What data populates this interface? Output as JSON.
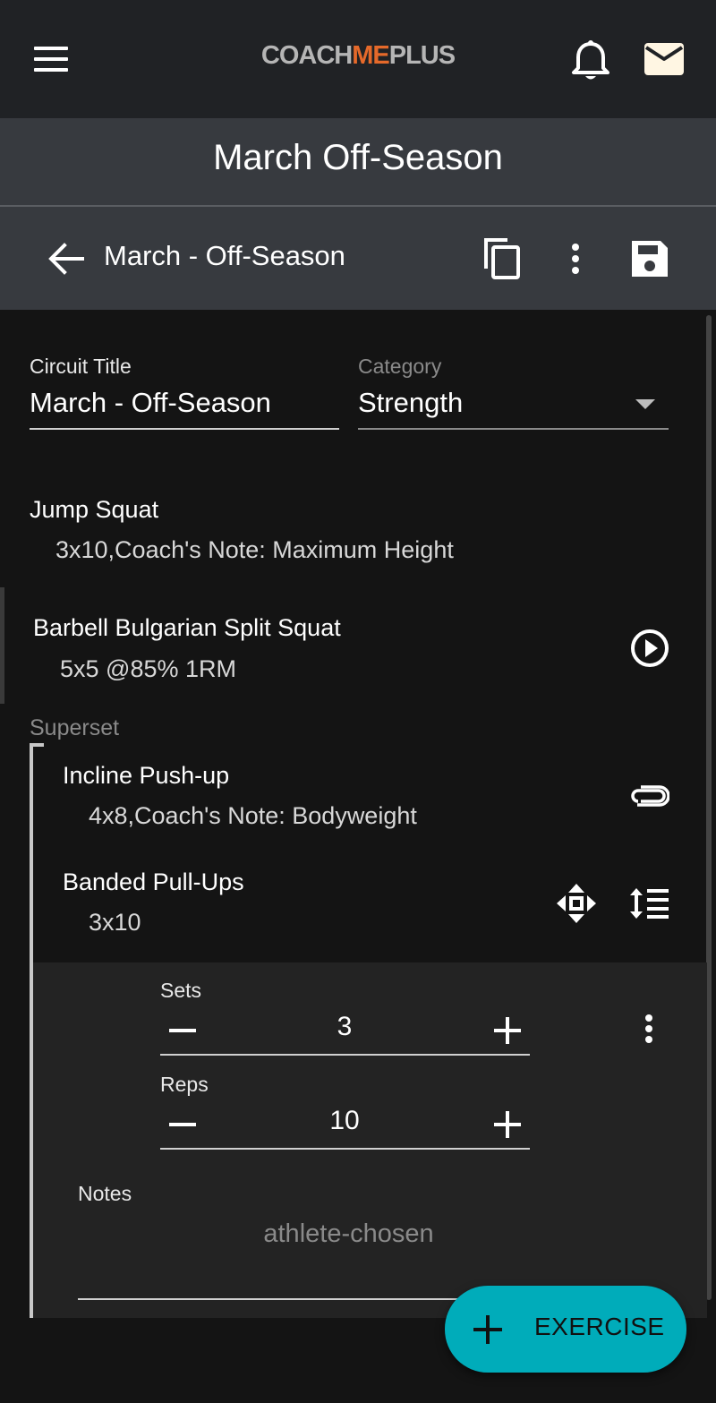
{
  "header": {
    "logo_part1": "COACH",
    "logo_part2": "ME",
    "logo_part3": "PLUS",
    "page_title": "March Off-Season"
  },
  "subheader": {
    "title": "March - Off-Season"
  },
  "form": {
    "circuit_title_label": "Circuit Title",
    "circuit_title_value": "March - Off-Season",
    "category_label": "Category",
    "category_value": "Strength"
  },
  "exercises": [
    {
      "name": "Jump Squat",
      "detail": "3x10,Coach's Note: Maximum Height"
    },
    {
      "name": "Barbell Bulgarian Split Squat",
      "detail": "5x5 @85% 1RM"
    }
  ],
  "superset": {
    "label": "Superset",
    "items": [
      {
        "name": "Incline Push-up",
        "detail": "4x8,Coach's Note: Bodyweight"
      },
      {
        "name": "Banded Pull-Ups",
        "detail": "3x10"
      }
    ]
  },
  "editor": {
    "sets_label": "Sets",
    "sets_value": "3",
    "reps_label": "Reps",
    "reps_value": "10",
    "notes_label": "Notes",
    "notes_placeholder": "athlete-chosen"
  },
  "fab": {
    "label": "EXERCISE"
  },
  "colors": {
    "accent": "#00acba",
    "logo_orange": "#e5692a",
    "topbar": "#202225",
    "subbar": "#373a3f",
    "background": "#141414"
  }
}
